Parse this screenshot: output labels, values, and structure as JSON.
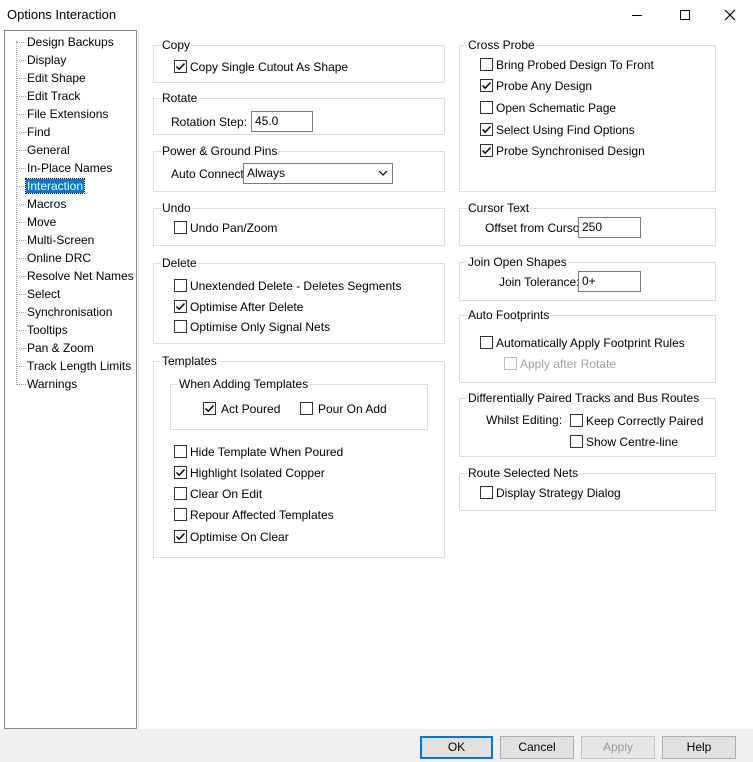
{
  "window": {
    "title": "Options  Interaction"
  },
  "tree": {
    "items": [
      "Design Backups",
      "Display",
      "Edit Shape",
      "Edit Track",
      "File Extensions",
      "Find",
      "General",
      "In-Place Names",
      "Interaction",
      "Macros",
      "Move",
      "Multi-Screen",
      "Online DRC",
      "Resolve Net Names",
      "Select",
      "Synchronisation",
      "Tooltips",
      "Pan & Zoom",
      "Track Length Limits",
      "Warnings"
    ],
    "selected": "Interaction"
  },
  "copy": {
    "legend": "Copy",
    "copy_single_cutout": {
      "label": "Copy Single Cutout As Shape",
      "checked": true
    }
  },
  "rotate": {
    "legend": "Rotate",
    "step_label": "Rotation Step:",
    "step_value": "45.0"
  },
  "power_ground": {
    "legend": "Power & Ground Pins",
    "auto_connect_label": "Auto Connect:",
    "auto_connect_value": "Always"
  },
  "undo": {
    "legend": "Undo",
    "undo_pan_zoom": {
      "label": "Undo Pan/Zoom",
      "checked": false
    }
  },
  "delete": {
    "legend": "Delete",
    "unextended": {
      "label": "Unextended Delete - Deletes Segments",
      "checked": false
    },
    "optimise_after": {
      "label": "Optimise After Delete",
      "checked": true
    },
    "optimise_signal": {
      "label": "Optimise Only Signal Nets",
      "checked": false
    }
  },
  "templates": {
    "legend": "Templates",
    "adding_legend": "When Adding Templates",
    "act_poured": {
      "label": "Act Poured",
      "checked": true
    },
    "pour_on_add": {
      "label": "Pour On Add",
      "checked": false
    },
    "hide_when_poured": {
      "label": "Hide Template When Poured",
      "checked": false
    },
    "highlight_isolated": {
      "label": "Highlight Isolated Copper",
      "checked": true
    },
    "clear_on_edit": {
      "label": "Clear On Edit",
      "checked": false
    },
    "repour_affected": {
      "label": "Repour Affected Templates",
      "checked": false
    },
    "optimise_on_clear": {
      "label": "Optimise On Clear",
      "checked": true
    }
  },
  "cross_probe": {
    "legend": "Cross Probe",
    "bring_to_front": {
      "label": "Bring Probed Design To Front",
      "checked": false
    },
    "probe_any": {
      "label": "Probe Any Design",
      "checked": true
    },
    "open_schematic": {
      "label": "Open Schematic Page",
      "checked": false
    },
    "select_find": {
      "label": "Select Using Find Options",
      "checked": true
    },
    "probe_sync": {
      "label": "Probe Synchronised Design",
      "checked": true
    }
  },
  "cursor_text": {
    "legend": "Cursor Text",
    "offset_label": "Offset from Cursor:",
    "offset_value": "250"
  },
  "join_open": {
    "legend": "Join Open Shapes",
    "tolerance_label": "Join Tolerance:",
    "tolerance_value": "0+"
  },
  "auto_footprints": {
    "legend": "Auto Footprints",
    "apply_rules": {
      "label": "Automatically Apply Footprint Rules",
      "checked": false
    },
    "apply_after_rotate": {
      "label": "Apply after Rotate",
      "checked": false
    }
  },
  "diff_pairs": {
    "legend": "Differentially Paired Tracks and Bus Routes",
    "whilst_label": "Whilst Editing:",
    "keep_paired": {
      "label": "Keep Correctly Paired",
      "checked": false
    },
    "show_centreline": {
      "label": "Show Centre-line",
      "checked": false
    }
  },
  "route_selected": {
    "legend": "Route Selected Nets",
    "display_strategy": {
      "label": "Display Strategy Dialog",
      "checked": false
    }
  },
  "buttons": {
    "ok": "OK",
    "cancel": "Cancel",
    "apply": "Apply",
    "help": "Help"
  },
  "colors": {
    "selection": "#0078d7",
    "button_face": "#e1e1e1",
    "group_border": "#dcdcdc"
  }
}
